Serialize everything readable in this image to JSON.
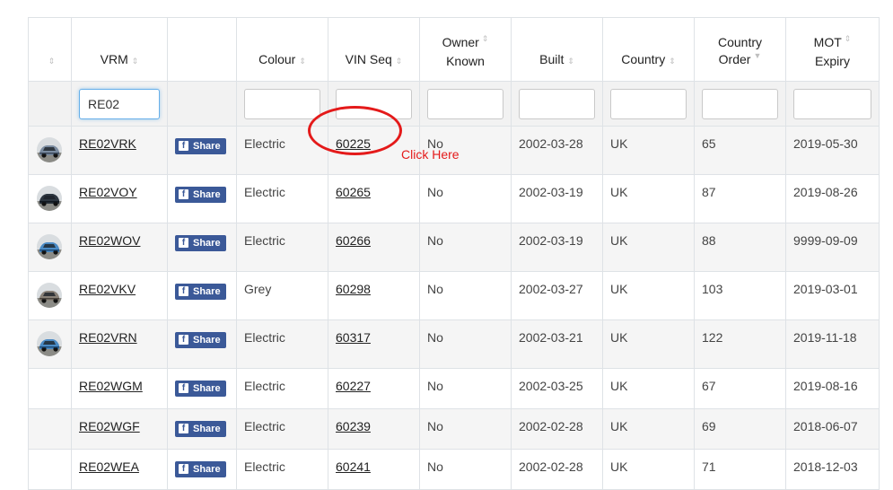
{
  "headers": [
    {
      "label": "",
      "sort": "both"
    },
    {
      "label": "VRM",
      "sort": "both"
    },
    {
      "label": "",
      "sort": "none"
    },
    {
      "label": "Colour",
      "sort": "both"
    },
    {
      "label": "VIN Seq",
      "sort": "both"
    },
    {
      "label": "Owner Known",
      "sort": "both"
    },
    {
      "label": "Built",
      "sort": "both"
    },
    {
      "label": "Country",
      "sort": "both"
    },
    {
      "label": "Country Order",
      "sort": "desc"
    },
    {
      "label": "MOT Expiry",
      "sort": "both"
    }
  ],
  "filters": {
    "vrm": "RE02",
    "colour": "",
    "vin_seq": "",
    "owner_known": "",
    "built": "",
    "country": "",
    "country_order": "",
    "mot_expiry": ""
  },
  "share_label": "Share",
  "rows": [
    {
      "vrm": "RE02VRK",
      "colour": "Electric",
      "vin": "60225",
      "owner": "No",
      "built": "2002-03-28",
      "country": "UK",
      "order": "65",
      "mot": "2019-05-30",
      "photo": "car-silver-blue"
    },
    {
      "vrm": "RE02VOY",
      "colour": "Electric",
      "vin": "60265",
      "owner": "No",
      "built": "2002-03-19",
      "country": "UK",
      "order": "87",
      "mot": "2019-08-26",
      "photo": "car-dark"
    },
    {
      "vrm": "RE02WOV",
      "colour": "Electric",
      "vin": "60266",
      "owner": "No",
      "built": "2002-03-19",
      "country": "UK",
      "order": "88",
      "mot": "9999-09-09",
      "photo": "car-blue"
    },
    {
      "vrm": "RE02VKV",
      "colour": "Grey",
      "vin": "60298",
      "owner": "No",
      "built": "2002-03-27",
      "country": "UK",
      "order": "103",
      "mot": "2019-03-01",
      "photo": "car-grey"
    },
    {
      "vrm": "RE02VRN",
      "colour": "Electric",
      "vin": "60317",
      "owner": "No",
      "built": "2002-03-21",
      "country": "UK",
      "order": "122",
      "mot": "2019-11-18",
      "photo": "car-blue"
    },
    {
      "vrm": "RE02WGM",
      "colour": "Electric",
      "vin": "60227",
      "owner": "No",
      "built": "2002-03-25",
      "country": "UK",
      "order": "67",
      "mot": "2019-08-16",
      "photo": ""
    },
    {
      "vrm": "RE02WGF",
      "colour": "Electric",
      "vin": "60239",
      "owner": "No",
      "built": "2002-02-28",
      "country": "UK",
      "order": "69",
      "mot": "2018-06-07",
      "photo": ""
    },
    {
      "vrm": "RE02WEA",
      "colour": "Electric",
      "vin": "60241",
      "owner": "No",
      "built": "2002-02-28",
      "country": "UK",
      "order": "71",
      "mot": "2018-12-03",
      "photo": ""
    }
  ],
  "annotation": {
    "text": "Click Here",
    "color": "#e41a1a"
  },
  "colors": {
    "share": "#3b5998",
    "stripe": "#f5f5f5",
    "border": "#dee2e6"
  }
}
